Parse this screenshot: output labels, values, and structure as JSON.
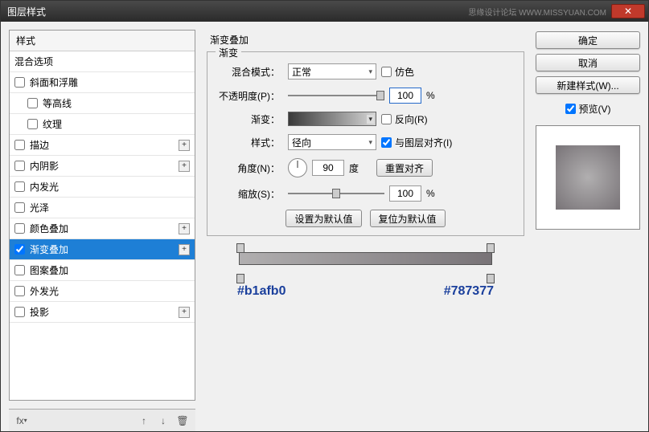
{
  "window_title": "图层样式",
  "watermark_text": "思缘设计论坛  WWW.MISSYUAN.COM",
  "left": {
    "header": "样式",
    "blend_options": "混合选项",
    "items": [
      {
        "label": "斜面和浮雕",
        "checked": false,
        "plus": false,
        "indent": false
      },
      {
        "label": "等高线",
        "checked": false,
        "plus": false,
        "indent": true
      },
      {
        "label": "纹理",
        "checked": false,
        "plus": false,
        "indent": true
      },
      {
        "label": "描边",
        "checked": false,
        "plus": true,
        "indent": false
      },
      {
        "label": "内阴影",
        "checked": false,
        "plus": true,
        "indent": false
      },
      {
        "label": "内发光",
        "checked": false,
        "plus": false,
        "indent": false
      },
      {
        "label": "光泽",
        "checked": false,
        "plus": false,
        "indent": false
      },
      {
        "label": "颜色叠加",
        "checked": false,
        "plus": true,
        "indent": false
      },
      {
        "label": "渐变叠加",
        "checked": true,
        "plus": true,
        "indent": false,
        "selected": true
      },
      {
        "label": "图案叠加",
        "checked": false,
        "plus": false,
        "indent": false
      },
      {
        "label": "外发光",
        "checked": false,
        "plus": false,
        "indent": false
      },
      {
        "label": "投影",
        "checked": false,
        "plus": true,
        "indent": false
      }
    ]
  },
  "middle": {
    "group_title": "渐变叠加",
    "fieldset_title": "渐变",
    "blend_mode_label": "混合模式：",
    "blend_mode_value": "正常",
    "dither_label": "仿色",
    "opacity_label": "不透明度(P)：",
    "opacity_value": "100",
    "percent": "%",
    "gradient_label": "渐变：",
    "reverse_label": "反向(R)",
    "style_label": "样式：",
    "style_value": "径向",
    "align_label": "与图层对齐(I)",
    "angle_label": "角度(N)：",
    "angle_value": "90",
    "degree": "度",
    "reset_align": "重置对齐",
    "scale_label": "缩放(S)：",
    "scale_value": "100",
    "set_default": "设置为默认值",
    "reset_default": "复位为默认值",
    "hex_left": "#b1afb0",
    "hex_right": "#787377"
  },
  "right": {
    "ok": "确定",
    "cancel": "取消",
    "new_style": "新建样式(W)...",
    "preview_label": "预览(V)"
  },
  "footer": {
    "fx": "fx"
  }
}
